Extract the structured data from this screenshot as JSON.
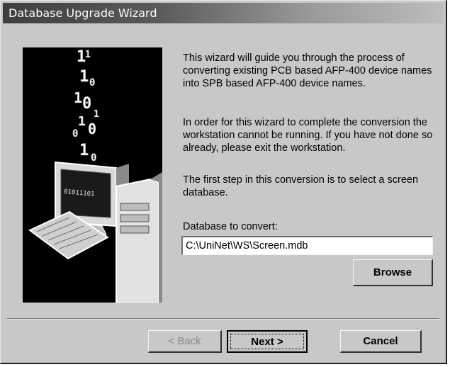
{
  "window": {
    "title": "Database Upgrade Wizard"
  },
  "graphic": {
    "binary_glyphs": [
      "1",
      "1",
      "0",
      "1",
      "0",
      "1",
      "0",
      "1",
      "0",
      "1",
      "1",
      "0"
    ],
    "screen_text": "01011101"
  },
  "content": {
    "paragraph1": "This wizard will guide you through the process of converting existing PCB based AFP-400 device names into SPB based AFP-400 device names.",
    "paragraph2": "In order for this wizard to complete the conversion the workstation cannot be running.  If you have not done so already, please exit the workstation.",
    "paragraph3": "The first step in this conversion is to select a screen database.",
    "field_label": "Database to convert:",
    "field_value": "C:\\UniNet\\WS\\Screen.mdb",
    "browse_label": "Browse"
  },
  "footer": {
    "back_label": "< Back",
    "next_label": "Next >",
    "cancel_label": "Cancel"
  },
  "colors": {
    "dialog_bg": "#c8c8c8",
    "titlebar_start": "#3e3e3e",
    "titlebar_end": "#bdbdbd",
    "disabled_text": "#8a8a8a"
  }
}
